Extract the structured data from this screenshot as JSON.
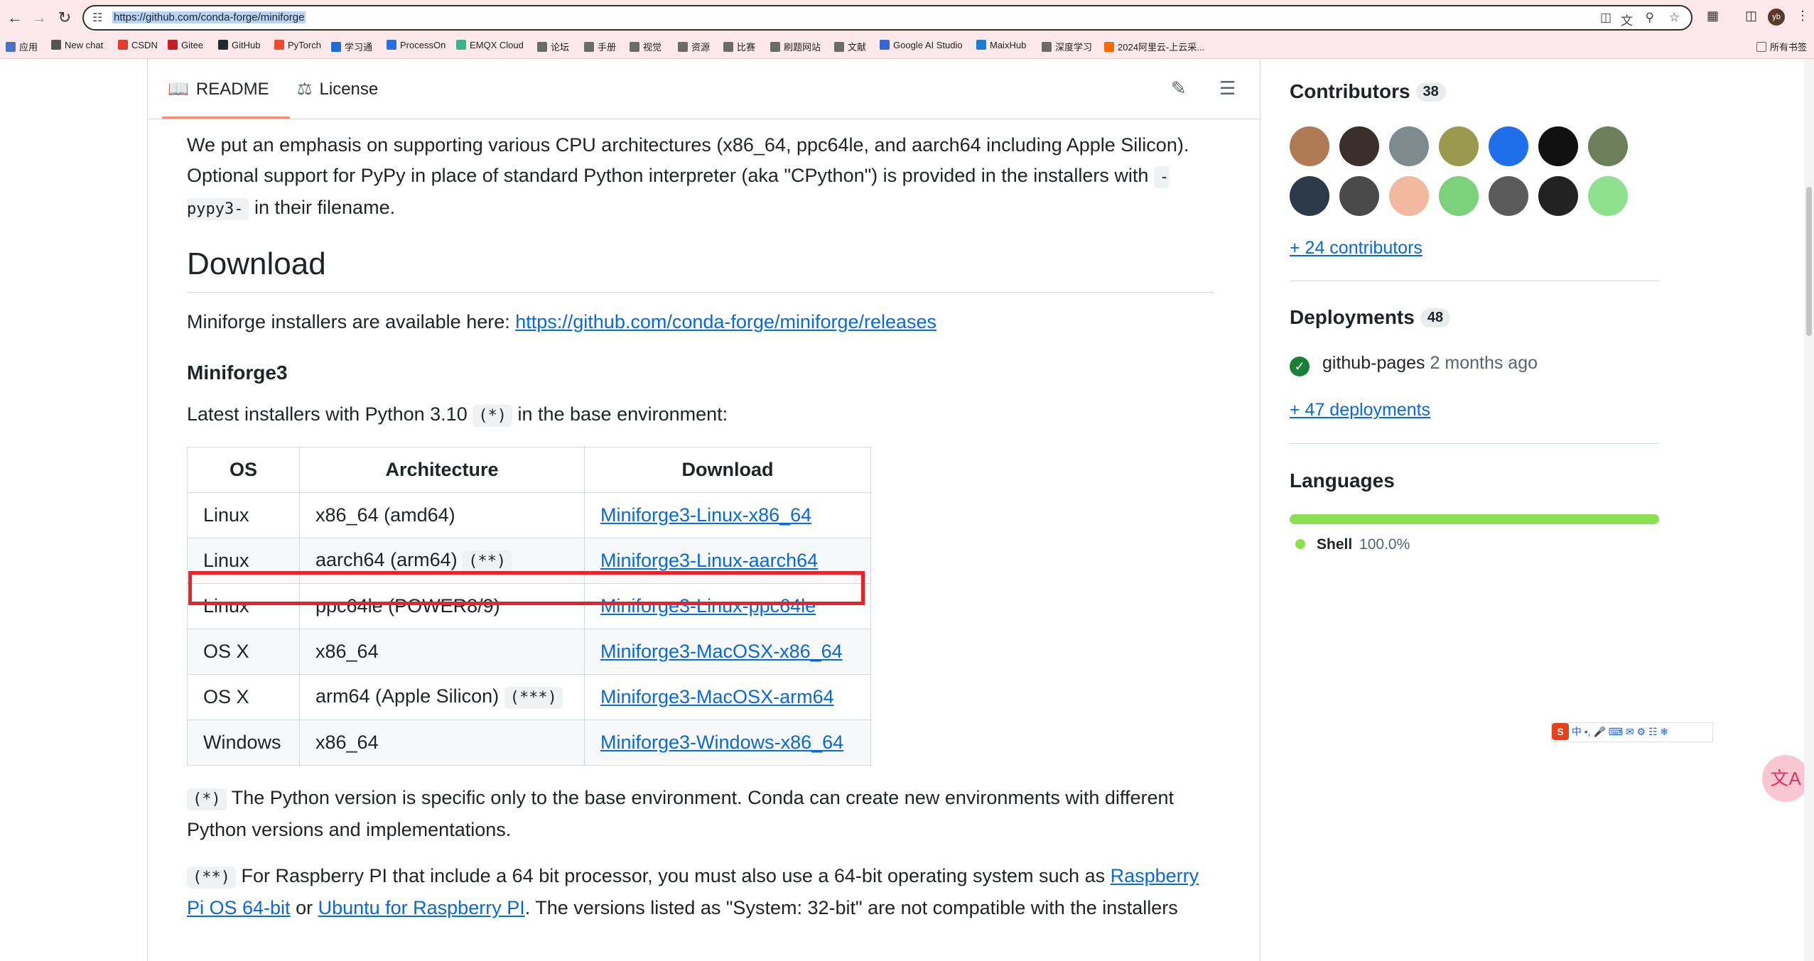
{
  "browser": {
    "url": "https://github.com/conda-forge/miniforge",
    "profile_initials": "yb",
    "bookmarks": [
      {
        "label": "应用",
        "color": "#4a72c4"
      },
      {
        "label": "New chat",
        "color": "#555555"
      },
      {
        "label": "CSDN",
        "color": "#e33b2e"
      },
      {
        "label": "Gitee",
        "color": "#c71d23"
      },
      {
        "label": "GitHub",
        "color": "#24292f"
      },
      {
        "label": "PyTorch",
        "color": "#ee4c2c"
      },
      {
        "label": "学习通",
        "color": "#1b6fd6"
      },
      {
        "label": "ProcessOn",
        "color": "#2a6fdc"
      },
      {
        "label": "EMQX Cloud",
        "color": "#3ab38a"
      },
      {
        "label": "论坛",
        "color": "#6b6b6b"
      },
      {
        "label": "手册",
        "color": "#6b6b6b"
      },
      {
        "label": "视觉",
        "color": "#6b6b6b"
      },
      {
        "label": "资源",
        "color": "#6b6b6b"
      },
      {
        "label": "比赛",
        "color": "#6b6b6b"
      },
      {
        "label": "刷题网站",
        "color": "#6b6b6b"
      },
      {
        "label": "文献",
        "color": "#6b6b6b"
      },
      {
        "label": "Google AI Studio",
        "color": "#3567d6"
      },
      {
        "label": "MaixHub",
        "color": "#1a7bd6"
      },
      {
        "label": "深度学习",
        "color": "#6b6b6b"
      },
      {
        "label": "2024阿里云-上云采...",
        "color": "#ff6a00"
      }
    ],
    "all_bookmarks": "所有书签"
  },
  "readme": {
    "tab_readme": "README",
    "tab_license": "License",
    "intro_1": "We put an emphasis on supporting various CPU architectures (x86_64, ppc64le, and aarch64 including Apple Silicon). Optional support for PyPy in place of standard Python interpreter (aka \"CPython\") is provided in the installers with ",
    "intro_code": "-pypy3-",
    "intro_2": " in their filename.",
    "download_heading": "Download",
    "installers_text": "Miniforge installers are available here: ",
    "installers_link": "https://github.com/conda-forge/miniforge/releases",
    "miniforge3_heading": "Miniforge3",
    "latest_1": "Latest installers with Python 3.10 ",
    "latest_code": "(*)",
    "latest_2": " in the base environment:",
    "table": {
      "headers": [
        "OS",
        "Architecture",
        "Download"
      ],
      "rows": [
        {
          "os": "Linux",
          "arch": "x86_64 (amd64)",
          "note": "",
          "link": "Miniforge3-Linux-x86_64"
        },
        {
          "os": "Linux",
          "arch": "aarch64 (arm64)",
          "note": "(**)",
          "link": "Miniforge3-Linux-aarch64"
        },
        {
          "os": "Linux",
          "arch": "ppc64le (POWER8/9)",
          "note": "",
          "link": "Miniforge3-Linux-ppc64le"
        },
        {
          "os": "OS X",
          "arch": "x86_64",
          "note": "",
          "link": "Miniforge3-MacOSX-x86_64"
        },
        {
          "os": "OS X",
          "arch": "arm64 (Apple Silicon)",
          "note": "(***)",
          "link": "Miniforge3-MacOSX-arm64"
        },
        {
          "os": "Windows",
          "arch": "x86_64",
          "note": "",
          "link": "Miniforge3-Windows-x86_64"
        }
      ]
    },
    "note1_code": "(*)",
    "note1_text": " The Python version is specific only to the base environment. Conda can create new environments with different Python versions and implementations.",
    "note2_code": "(**)",
    "note2_text_1": " For Raspberry PI that include a 64 bit processor, you must also use a 64-bit operating system such as ",
    "note2_link_1": "Raspberry Pi OS 64-bit",
    "note2_text_2": " or ",
    "note2_link_2": "Ubuntu for Raspberry PI",
    "note2_text_3": ". The versions listed as \"System: 32-bit\" are not compatible with the installers"
  },
  "sidebar": {
    "contributors_label": "Contributors",
    "contributors_count": "38",
    "more_contributors": "+ 24 contributors",
    "avatar_colors": [
      "#b07a55",
      "#3a2f2a",
      "#7d8a8e",
      "#9a9a4f",
      "#1f6feb",
      "#111111",
      "#6b7f5a",
      "#2d3a4a",
      "#4a4a4a",
      "#f2b8a0",
      "#7bd27b",
      "#5b5b5b",
      "#222222",
      "#8fe08f"
    ],
    "deployments_label": "Deployments",
    "deployments_count": "48",
    "deployment_name": "github-pages",
    "deployment_time": "2 months ago",
    "more_deployments": "+ 47 deployments",
    "languages_label": "Languages",
    "language_name": "Shell",
    "language_pct": "100.0%",
    "language_color": "#89e051"
  }
}
